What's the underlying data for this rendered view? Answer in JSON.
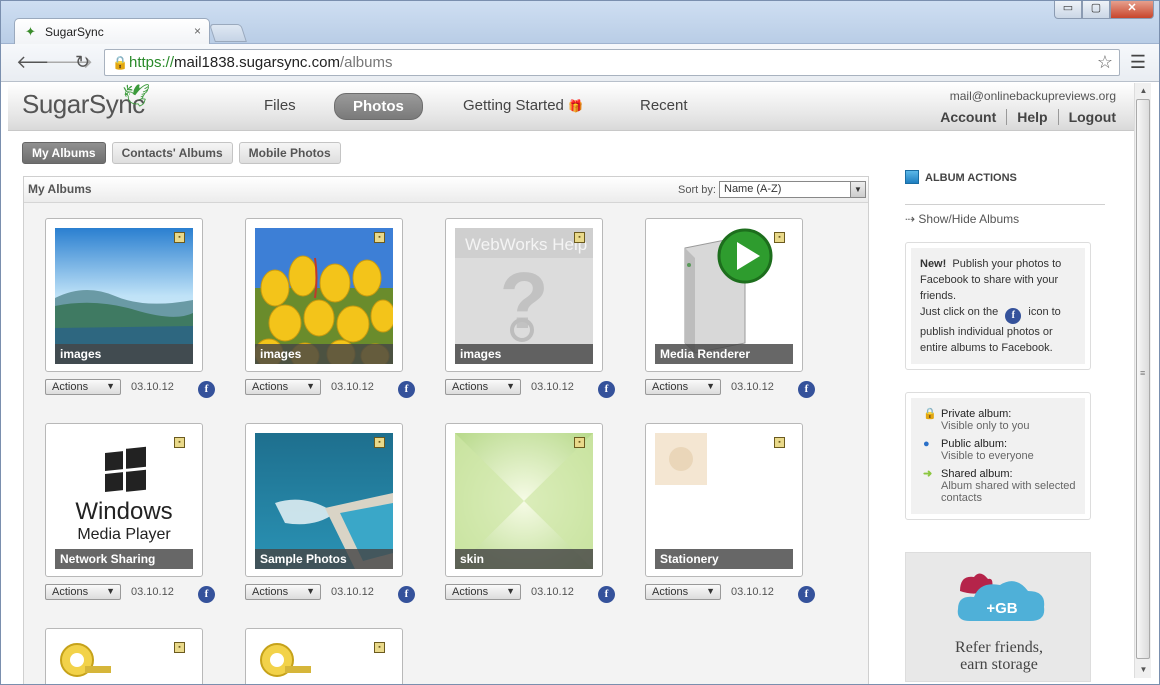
{
  "browser": {
    "tab_title": "SugarSync",
    "tab_close": "×",
    "url_scheme": "https://",
    "url_host": "mail1838.sugarsync.com",
    "url_path": "/albums",
    "window_buttons": {
      "minimize": "▭",
      "maximize": "▢",
      "close": "✕"
    }
  },
  "header": {
    "logo": "SugarSync",
    "nav": [
      {
        "label": "Files"
      },
      {
        "label": "Photos",
        "active": true
      },
      {
        "label": "Getting Started"
      },
      {
        "label": "Recent"
      }
    ],
    "account_email": "mail@onlinebackupreviews.org",
    "account_links": [
      "Account",
      "Help",
      "Logout"
    ]
  },
  "subtabs": [
    {
      "label": "My Albums",
      "active": true
    },
    {
      "label": "Contacts' Albums"
    },
    {
      "label": "Mobile Photos"
    }
  ],
  "panel": {
    "title": "My Albums",
    "sort_label": "Sort by:",
    "sort_value": "Name (A-Z)"
  },
  "albums": [
    {
      "label": "images",
      "date": "03.10.12",
      "actions": "Actions",
      "fb": "f"
    },
    {
      "label": "images",
      "date": "03.10.12",
      "actions": "Actions",
      "fb": "f"
    },
    {
      "label": "images",
      "date": "03.10.12",
      "actions": "Actions",
      "fb": "f"
    },
    {
      "label": "Media Renderer",
      "date": "03.10.12",
      "actions": "Actions",
      "fb": "f"
    },
    {
      "label": "Network Sharing",
      "date": "03.10.12",
      "actions": "Actions",
      "fb": "f"
    },
    {
      "label": "Sample Photos",
      "date": "03.10.12",
      "actions": "Actions",
      "fb": "f"
    },
    {
      "label": "skin",
      "date": "03.10.12",
      "actions": "Actions",
      "fb": "f"
    },
    {
      "label": "Stationery",
      "date": "03.10.12",
      "actions": "Actions",
      "fb": "f"
    }
  ],
  "thumb_text": {
    "webworks": "WebWorks Help",
    "windows": "Windows",
    "media_player": "Media Player"
  },
  "sidebar": {
    "heading": "ALBUM ACTIONS",
    "show_hide": "Show/Hide Albums",
    "promo_new": "New!",
    "promo_line1": "Publish your photos to Facebook to share with your friends.",
    "promo_line2a": "Just click on the",
    "promo_line2b": "icon to publish individual photos or entire albums to Facebook.",
    "legend": [
      {
        "title": "Private album:",
        "desc": "Visible only to you"
      },
      {
        "title": "Public album:",
        "desc": "Visible to everyone"
      },
      {
        "title": "Shared album:",
        "desc": "Album shared with selected contacts"
      }
    ],
    "refer_badge": "+GB",
    "refer_line1": "Refer friends,",
    "refer_line2": "earn storage"
  },
  "colors": {
    "accent_green": "#3b9a3b",
    "facebook_blue": "#35529b",
    "active_tab": "#7a7a7a"
  }
}
